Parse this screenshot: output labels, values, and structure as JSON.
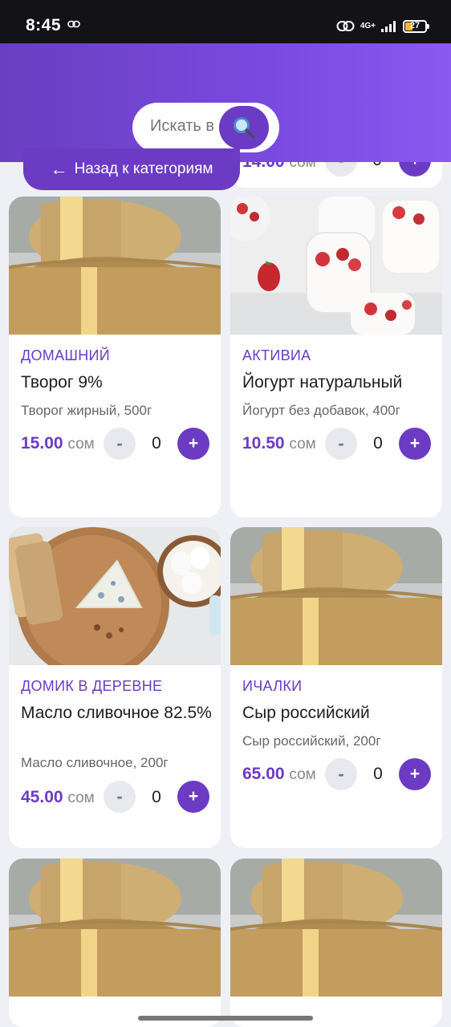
{
  "status": {
    "time": "8:45",
    "network": "4G+",
    "battery": "27"
  },
  "search": {
    "placeholder": "Искать в"
  },
  "back": {
    "label": "Назад к категориям"
  },
  "partial_card": {
    "price": "14.00",
    "currency": "сом",
    "qty": "0",
    "minus": "-",
    "plus": "+"
  },
  "products": [
    {
      "brand": "ДОМАШНИЙ",
      "name": "Творог 9%",
      "desc": "Творог жирный, 500г",
      "price": "15.00",
      "currency": "сом",
      "qty": "0",
      "minus": "-",
      "plus": "+",
      "image": "cheese"
    },
    {
      "brand": "АКТИВИА",
      "name": "Йогурт натуральный",
      "desc": "Йогурт без добавок, 400г",
      "price": "10.50",
      "currency": "сом",
      "qty": "0",
      "minus": "-",
      "plus": "+",
      "image": "yogurt"
    },
    {
      "brand": "ДОМИК В ДЕРЕВНЕ",
      "name": "Масло сливочное 82.5%",
      "desc": "Масло сливочное, 200г",
      "price": "45.00",
      "currency": "сом",
      "qty": "0",
      "minus": "-",
      "plus": "+",
      "image": "board"
    },
    {
      "brand": "ИЧАЛКИ",
      "name": "Сыр российский",
      "desc": "Сыр российский, 200г",
      "price": "65.00",
      "currency": "сом",
      "qty": "0",
      "minus": "-",
      "plus": "+",
      "image": "cheese"
    },
    {
      "image": "cheese"
    },
    {
      "image": "cheese"
    }
  ],
  "colors": {
    "accent": "#6c3bc4",
    "header_from": "#6a3fc0",
    "header_to": "#8b58f0"
  }
}
